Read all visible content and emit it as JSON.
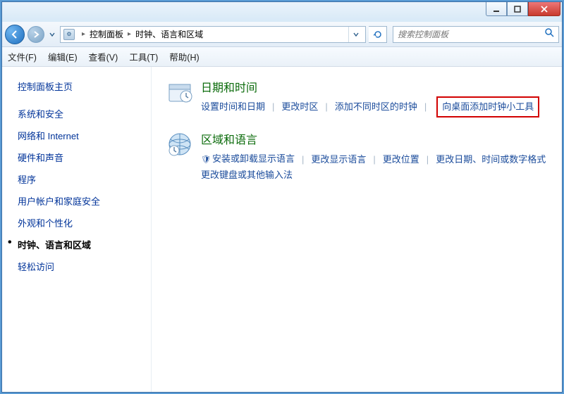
{
  "titlebar": {
    "min": "—",
    "max": "□",
    "close": "×"
  },
  "nav": {
    "crumbs": [
      "控制面板",
      "时钟、语言和区域"
    ],
    "search_placeholder": "搜索控制面板"
  },
  "menubar": [
    "文件(F)",
    "编辑(E)",
    "查看(V)",
    "工具(T)",
    "帮助(H)"
  ],
  "sidebar": {
    "heading": "控制面板主页",
    "items": [
      {
        "label": "系统和安全",
        "active": false
      },
      {
        "label": "网络和 Internet",
        "active": false
      },
      {
        "label": "硬件和声音",
        "active": false
      },
      {
        "label": "程序",
        "active": false
      },
      {
        "label": "用户帐户和家庭安全",
        "active": false
      },
      {
        "label": "外观和个性化",
        "active": false
      },
      {
        "label": "时钟、语言和区域",
        "active": true
      },
      {
        "label": "轻松访问",
        "active": false
      }
    ]
  },
  "sections": [
    {
      "title": "日期和时间",
      "links": [
        {
          "label": "设置时间和日期"
        },
        {
          "label": "更改时区"
        },
        {
          "label": "添加不同时区的时钟"
        },
        {
          "label": "向桌面添加时钟小工具",
          "highlighted": true
        }
      ]
    },
    {
      "title": "区域和语言",
      "links": [
        {
          "label": "安装或卸载显示语言",
          "shield": true
        },
        {
          "label": "更改显示语言"
        },
        {
          "label": "更改位置"
        },
        {
          "label": "更改日期、时间或数字格式"
        },
        {
          "label": "更改键盘或其他输入法",
          "newline": true
        }
      ]
    }
  ]
}
